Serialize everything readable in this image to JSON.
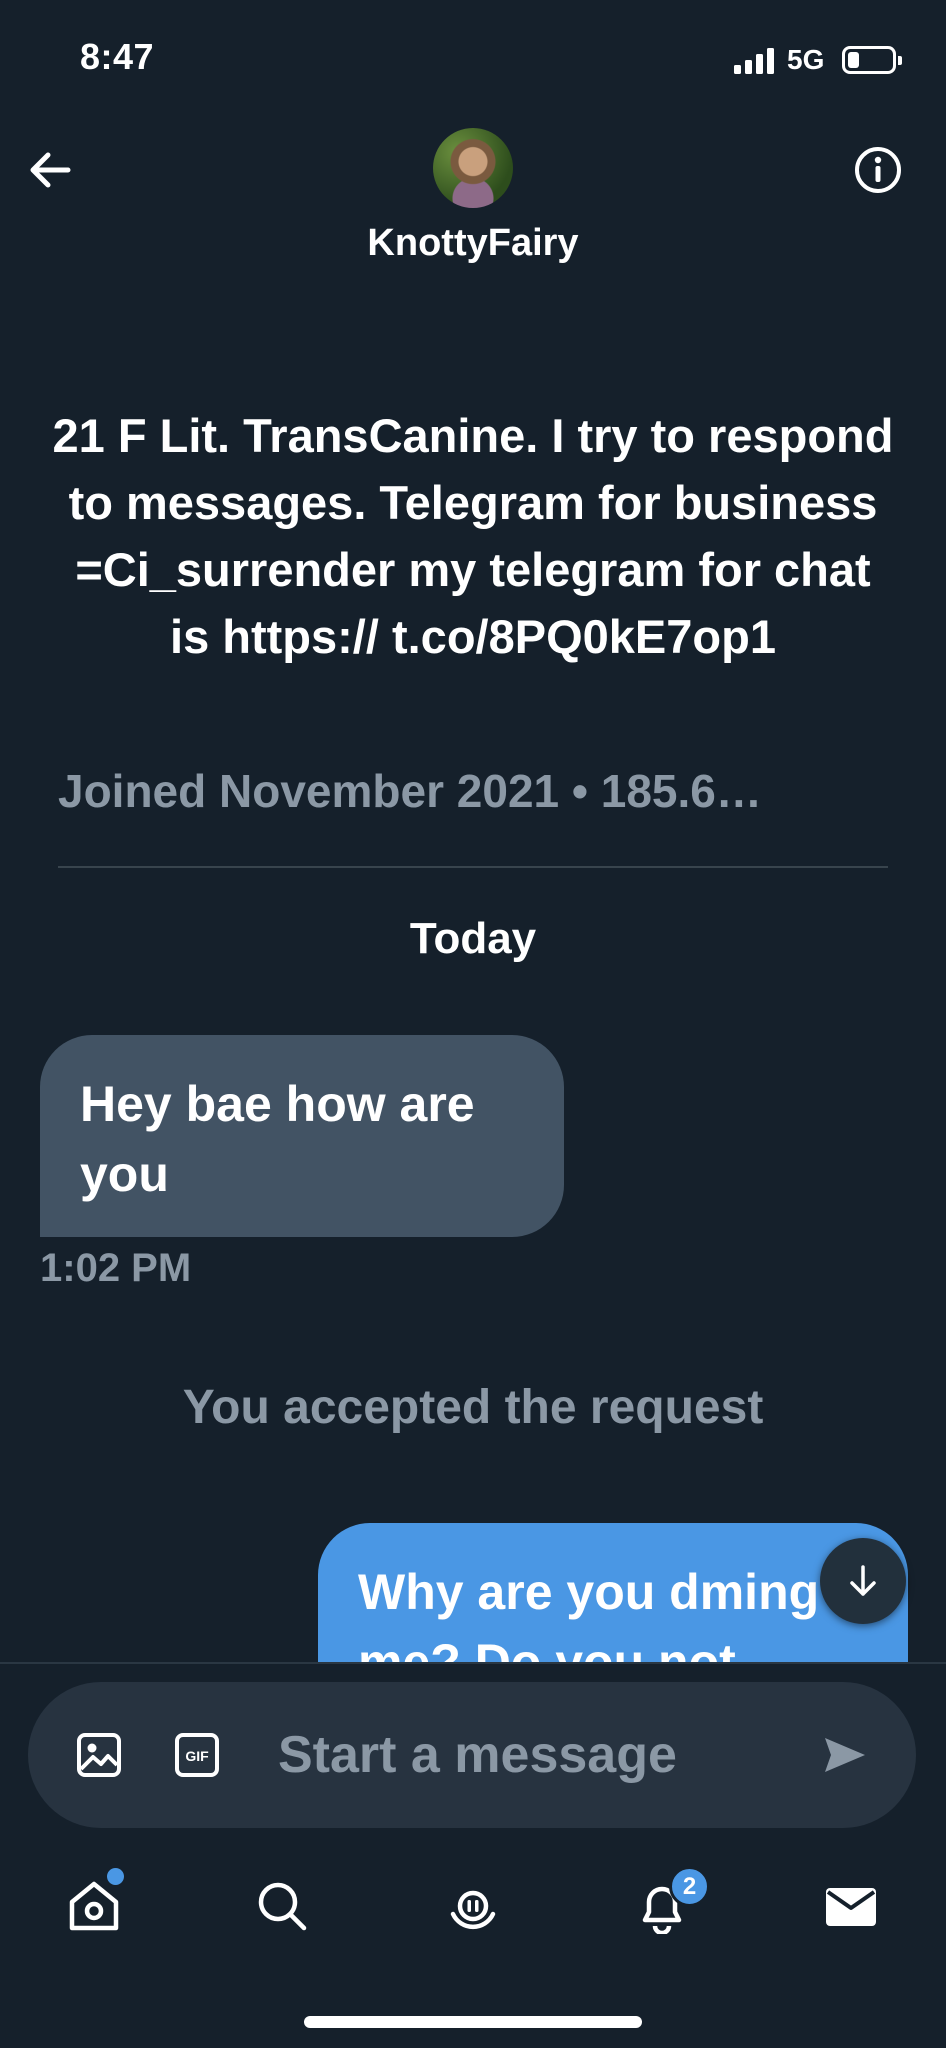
{
  "status_bar": {
    "time": "8:47",
    "network": "5G",
    "battery_level": 0.25
  },
  "header": {
    "name": "KnottyFairy",
    "back_icon": "arrow-left-icon",
    "info_icon": "info-icon"
  },
  "profile": {
    "bio": "21 F Lit. TransCanine. I try to respond to messages. Telegram for business =Ci_surrender my telegram for chat is https:// t.co/8PQ0kE7op1",
    "joined": "Joined November 2021 • 185.6…"
  },
  "conversation": {
    "day_separator": "Today",
    "messages": [
      {
        "direction": "in",
        "text": "Hey bae how are you",
        "time": "1:02 PM"
      },
      {
        "direction": "out",
        "text": "Why are you dming me? Do you not"
      }
    ],
    "system_notice": "You accepted the request"
  },
  "composer": {
    "placeholder": "Start a message",
    "gif_label": "GIF"
  },
  "nav": {
    "notification_count": "2"
  },
  "colors": {
    "background": "#15202b",
    "accent": "#4a97e4",
    "incoming_bubble": "#425364",
    "muted_text": "#8b98a5"
  }
}
